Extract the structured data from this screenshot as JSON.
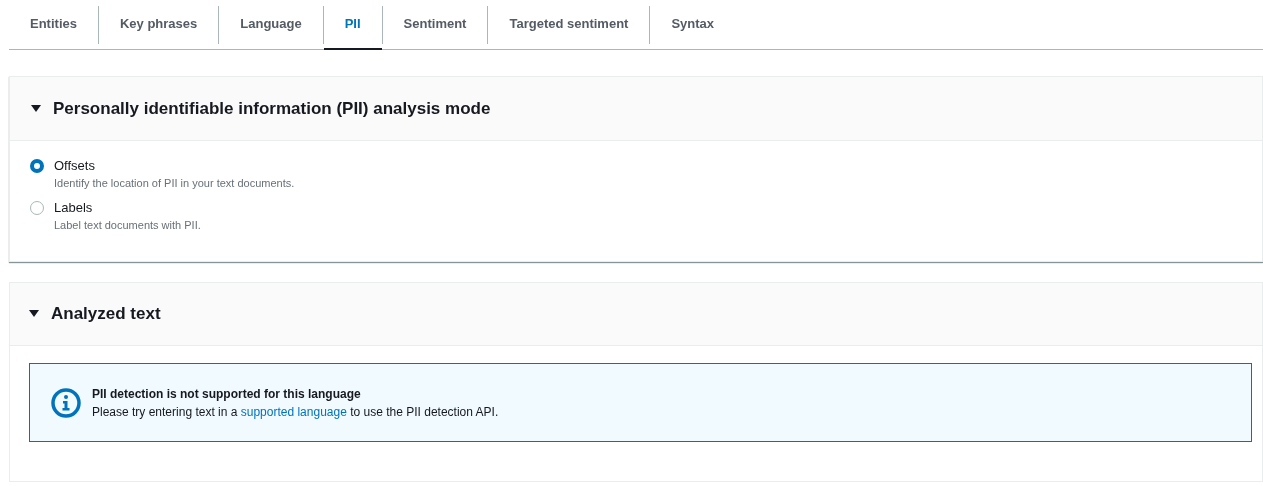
{
  "tabs": [
    {
      "label": "Entities",
      "selected": false
    },
    {
      "label": "Key phrases",
      "selected": false
    },
    {
      "label": "Language",
      "selected": false
    },
    {
      "label": "PII",
      "selected": true
    },
    {
      "label": "Sentiment",
      "selected": false
    },
    {
      "label": "Targeted sentiment",
      "selected": false
    },
    {
      "label": "Syntax",
      "selected": false
    }
  ],
  "mode_panel": {
    "title": "Personally identifiable information (PII) analysis mode",
    "expanded": true,
    "options": [
      {
        "label": "Offsets",
        "description": "Identify the location of PII in your text documents.",
        "selected": true
      },
      {
        "label": "Labels",
        "description": "Label text documents with PII.",
        "selected": false
      }
    ]
  },
  "analyzed_panel": {
    "title": "Analyzed text",
    "expanded": true,
    "alert": {
      "title": "PII detection is not supported for this language",
      "message_before": "Please try entering text in a ",
      "link": "supported language",
      "message_after": " to use the PII detection API."
    }
  }
}
